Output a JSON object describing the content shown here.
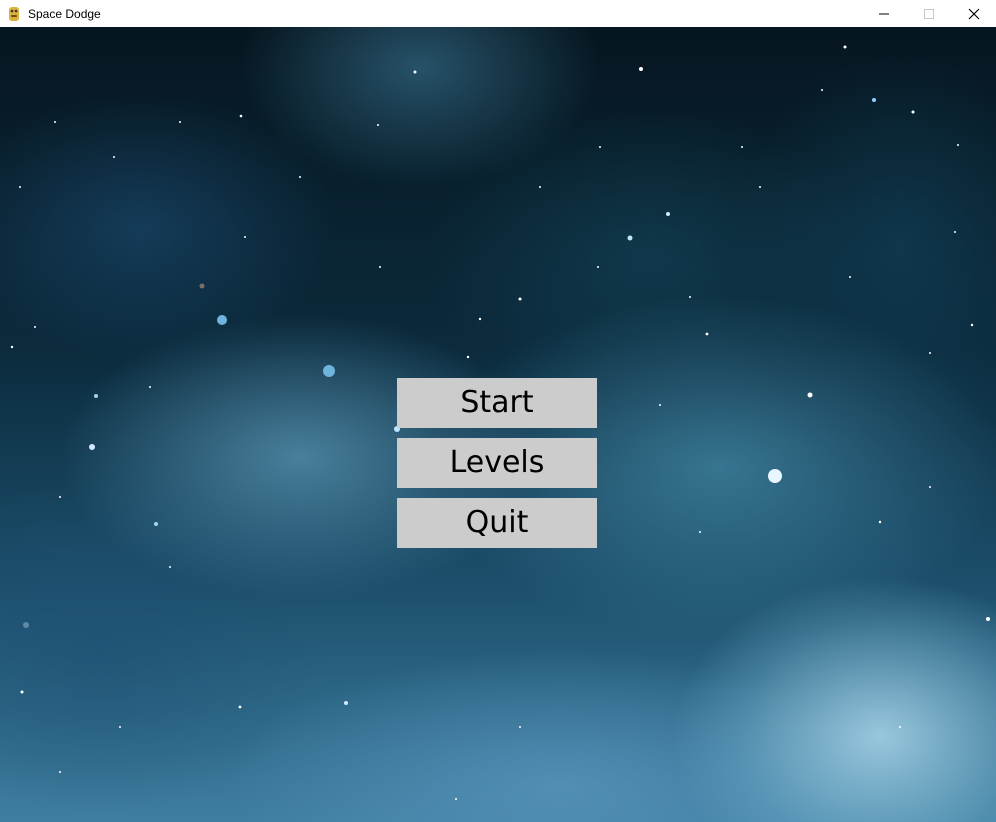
{
  "window": {
    "title": "Space Dodge",
    "controls": {
      "minimize_icon": "minimize-icon",
      "maximize_icon": "maximize-icon",
      "close_icon": "close-icon"
    },
    "app_icon": "python-logo-icon"
  },
  "menu": {
    "buttons": [
      {
        "label": "Start"
      },
      {
        "label": "Levels"
      },
      {
        "label": "Quit"
      }
    ]
  },
  "colors": {
    "button_bg": "#cccccc",
    "button_text": "#000000",
    "titlebar_bg": "#ffffff"
  },
  "background": "starfield-nebula"
}
